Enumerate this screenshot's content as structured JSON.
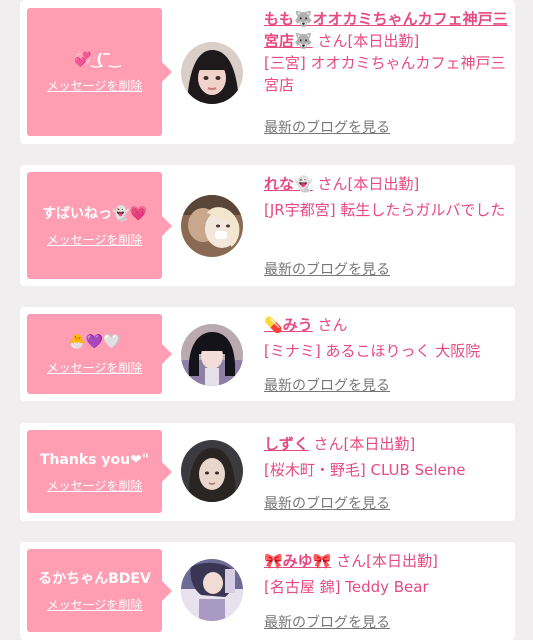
{
  "entries": [
    {
      "message": "💞 ͜(‾̃ ͜",
      "delete_label": "メッセージを削除",
      "name": "もも🐺オオカミちゃんカフェ神戸三宮店🐺",
      "honorific": "さん",
      "status": "[本日出勤]",
      "store": "[三宮] オオカミちゃんカフェ神戸三宮店",
      "blog_label": "最新のブログを見る",
      "avatar": "profile-photo"
    },
    {
      "message": "すばいねっ👻💗",
      "delete_label": "メッセージを削除",
      "name": "れな👻",
      "honorific": "さん",
      "status": "[本日出勤]",
      "store": "[JR宇都宮] 転生したらガルバでした",
      "blog_label": "最新のブログを見る",
      "avatar": "profile-photo"
    },
    {
      "message": "🐣💜🤍",
      "delete_label": "メッセージを削除",
      "name": "💊みう",
      "honorific": "さん",
      "status": "",
      "store": "[ミナミ] あるこほりっく 大阪院",
      "blog_label": "最新のブログを見る",
      "avatar": "profile-photo"
    },
    {
      "message": "Thanks you❤\"",
      "delete_label": "メッセージを削除",
      "name": "しずく",
      "honorific": "さん",
      "status": "[本日出勤]",
      "store": "[桜木町・野毛] CLUB Selene",
      "blog_label": "最新のブログを見る",
      "avatar": "profile-photo"
    },
    {
      "message": "るかちゃんBDEV",
      "delete_label": "メッセージを削除",
      "name": "🎀みゆ🎀",
      "honorific": "さん",
      "status": "[本日出勤]",
      "store": "[名古屋 錦] Teddy Bear",
      "blog_label": "最新のブログを見る",
      "avatar": "profile-photo"
    }
  ],
  "colors": {
    "accent": "#e64a7f",
    "bubble": "#ff9eb2",
    "background": "#f0eeee"
  }
}
